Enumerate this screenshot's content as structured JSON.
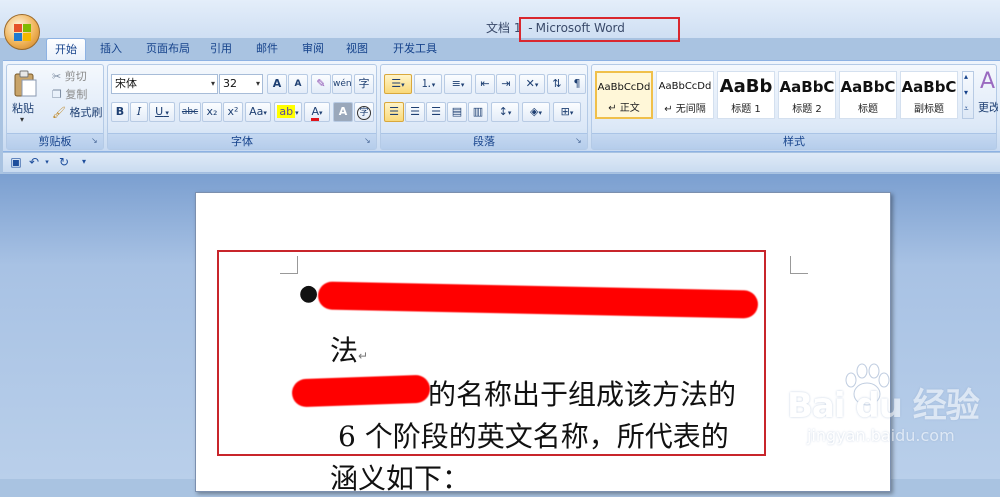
{
  "titlebar": {
    "doc_name": "文档 1",
    "separator": "-",
    "app_name": "Microsoft Word"
  },
  "tabs": [
    {
      "label": "开始",
      "active": true
    },
    {
      "label": "插入",
      "active": false
    },
    {
      "label": "页面布局",
      "active": false
    },
    {
      "label": "引用",
      "active": false
    },
    {
      "label": "邮件",
      "active": false
    },
    {
      "label": "审阅",
      "active": false
    },
    {
      "label": "视图",
      "active": false
    },
    {
      "label": "开发工具",
      "active": false
    }
  ],
  "clipboard": {
    "paste_label": "粘贴",
    "cut_label": "剪切",
    "copy_label": "复制",
    "format_painter_label": "格式刷",
    "group_label": "剪贴板"
  },
  "font": {
    "font_name": "宋体",
    "font_size": "32",
    "group_label": "字体",
    "pinyin_glyph": "wén",
    "border_char_glyph": "字",
    "char_shading_glyph": "A",
    "enclose_glyph": "字"
  },
  "paragraph": {
    "group_label": "段落"
  },
  "styles": {
    "group_label": "样式",
    "more_label": "更改",
    "items": [
      {
        "sample": "AaBbCcDd",
        "name": "正文",
        "active": true
      },
      {
        "sample": "AaBbCcDd",
        "name": "无间隔",
        "active": false
      },
      {
        "sample": "AaBb",
        "name": "标题 1",
        "active": false
      },
      {
        "sample": "AaBbC",
        "name": "标题 2",
        "active": false
      },
      {
        "sample": "AaBbC",
        "name": "标题",
        "active": false
      },
      {
        "sample": "AaBbC",
        "name": "副标题",
        "active": false
      }
    ]
  },
  "document": {
    "line1_tail": "法",
    "line2_tail": "的名称出于组成该方法的",
    "line3": "6 个阶段的英文名称，所代表的",
    "line4": "涵义如下："
  },
  "watermark": {
    "brand": "Bai du 经验",
    "url": "jingyan.baidu.com"
  },
  "colors": {
    "accent_red": "#d9272e",
    "ribbon_blue": "#dbe8f7",
    "doc_bg": "#a8c2e4"
  }
}
